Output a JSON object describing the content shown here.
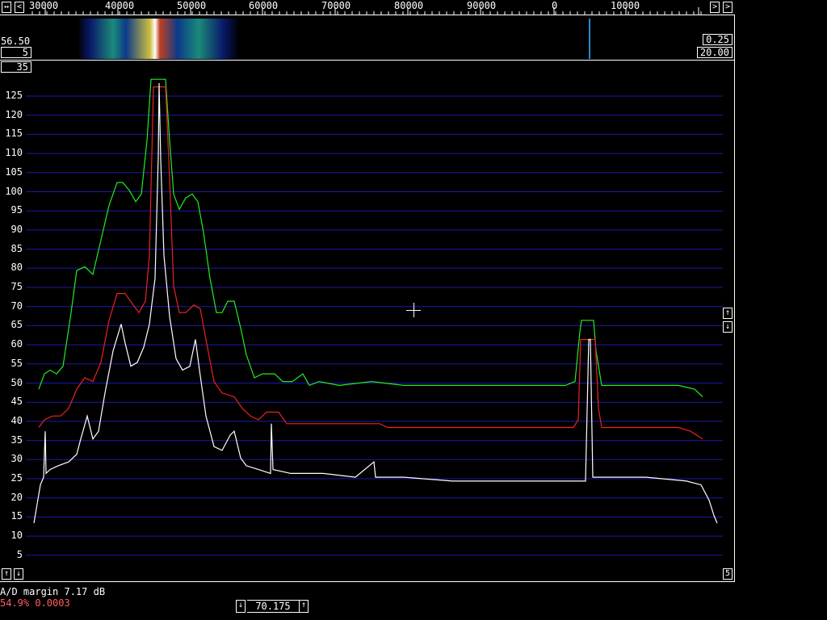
{
  "top_scale": {
    "freq_labels": [
      "30000",
      "40000",
      "50000",
      "60000",
      "70000",
      "80000",
      "90000",
      "0",
      "10000"
    ],
    "left_nav_icon": "arrow-left-icon",
    "right_nav_icon": "arrow-right-icon"
  },
  "waterfall": {
    "left_top_value": "56.50",
    "left_box_value": "5",
    "right_top_value": "0.25",
    "right_box_value": "20.00"
  },
  "spectrum": {
    "avg_box_value": "35",
    "y_ticks": [
      "125",
      "120",
      "115",
      "110",
      "105",
      "100",
      "95",
      "90",
      "85",
      "80",
      "75",
      "70",
      "65",
      "60",
      "55",
      "50",
      "45",
      "40",
      "35",
      "30",
      "25",
      "20",
      "15",
      "10",
      "5"
    ],
    "colors": {
      "green": "#22ee22",
      "red": "#ee2222",
      "white": "#ffffff",
      "grid": "#1a1aaa"
    }
  },
  "status": {
    "ad_margin": "A/D margin 7.17 dB",
    "load": "54.9% 0.0003",
    "freq_value": "70.175",
    "corner_right_value": "5"
  }
}
